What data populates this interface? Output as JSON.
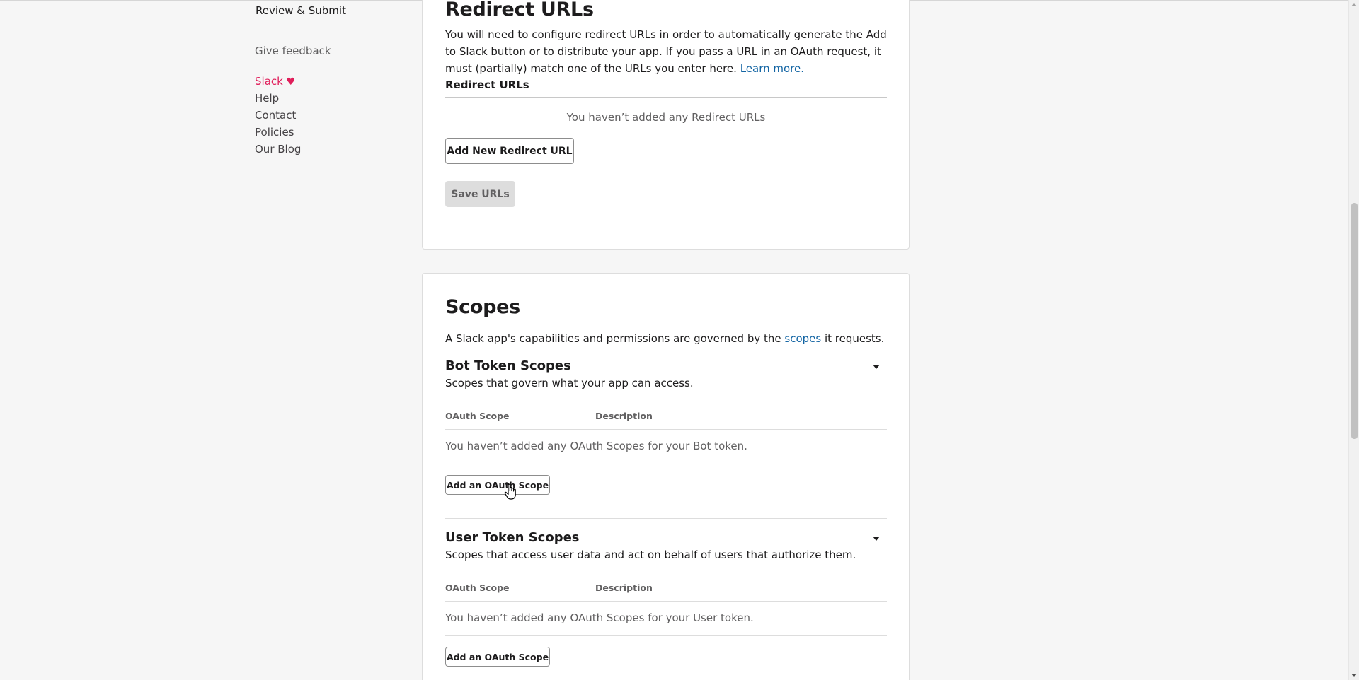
{
  "sidebar": {
    "review_submit": "Review & Submit",
    "give_feedback": "Give feedback",
    "slack": "Slack",
    "heart": "♥",
    "help": "Help",
    "contact": "Contact",
    "policies": "Policies",
    "our_blog": "Our Blog"
  },
  "redirect": {
    "title": "Redirect URLs",
    "description": "You will need to configure redirect URLs in order to automatically generate the Add to Slack button or to distribute your app. If you pass a URL in an OAuth request, it must (partially) match one of the URLs you enter here.",
    "learn_more": "Learn more.",
    "list_header": "Redirect URLs",
    "empty_message": "You haven’t added any Redirect URLs",
    "add_button": "Add New Redirect URL",
    "save_button": "Save URLs"
  },
  "scopes": {
    "title": "Scopes",
    "intro_before": "A Slack app's capabilities and permissions are governed by the ",
    "intro_link": "scopes",
    "intro_after": " it requests.",
    "bot": {
      "title": "Bot Token Scopes",
      "description": "Scopes that govern what your app can access.",
      "col_scope": "OAuth Scope",
      "col_description": "Description",
      "empty": "You haven’t added any OAuth Scopes for your Bot token.",
      "add_button": "Add an OAuth Scope"
    },
    "user": {
      "title": "User Token Scopes",
      "description": "Scopes that access user data and act on behalf of users that authorize them.",
      "col_scope": "OAuth Scope",
      "col_description": "Description",
      "empty": "You haven’t added any OAuth Scopes for your User token.",
      "add_button": "Add an OAuth Scope"
    }
  },
  "colors": {
    "link": "#1264a3",
    "brand_pink": "#e01e5a",
    "text": "#1d1c1d",
    "muted": "#616061"
  }
}
